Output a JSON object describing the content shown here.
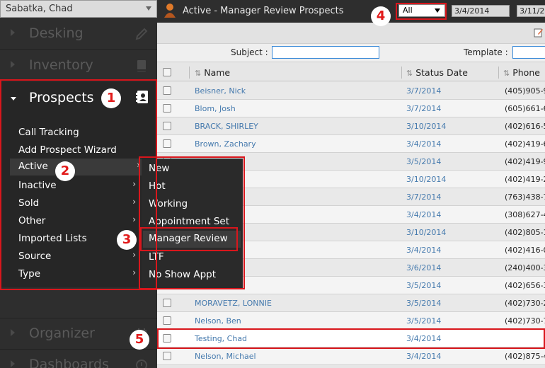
{
  "sidebar": {
    "user": "Sabatka, Chad",
    "sections": {
      "desking": "Desking",
      "inventory": "Inventory",
      "prospects": "Prospects",
      "organizer": "Organizer",
      "dashboards": "Dashboards"
    },
    "prospect_items": [
      "Call Tracking",
      "Add Prospect Wizard",
      "Active",
      "Inactive",
      "Sold",
      "Other",
      "Imported Lists",
      "Source",
      "Type"
    ]
  },
  "submenu": {
    "items": [
      "New",
      "Hot",
      "Working",
      "Appointment Set",
      "Manager Review",
      "LTF",
      "No Show Appt"
    ]
  },
  "header": {
    "title": "Active - Manager Review Prospects",
    "filter_value": "All",
    "date_start": "3/4/2014",
    "date_end": "3/11/201"
  },
  "search": {
    "subject_label": "Subject :",
    "template_label": "Template :"
  },
  "grid": {
    "columns": [
      "Name",
      "Status Date",
      "Phone"
    ],
    "rows": [
      {
        "name": "Beisner, Nick",
        "date": "3/7/2014",
        "phone": "(405)905-97"
      },
      {
        "name": "Blom, Josh",
        "date": "3/7/2014",
        "phone": "(605)661-64"
      },
      {
        "name": "BRACK, SHIRLEY",
        "date": "3/10/2014",
        "phone": "(402)616-51"
      },
      {
        "name": "Brown, Zachary",
        "date": "3/4/2014",
        "phone": "(402)419-63"
      },
      {
        "name": "",
        "date": "3/5/2014",
        "phone": "(402)419-93"
      },
      {
        "name": "",
        "date": "3/10/2014",
        "phone": "(402)419-24"
      },
      {
        "name": "",
        "date": "3/7/2014",
        "phone": "(763)438-76"
      },
      {
        "name": "",
        "date": "3/4/2014",
        "phone": "(308)627-43"
      },
      {
        "name": "",
        "date": "3/10/2014",
        "phone": "(402)805-11"
      },
      {
        "name": "",
        "date": "3/4/2014",
        "phone": "(402)416-08"
      },
      {
        "name": "",
        "date": "3/6/2014",
        "phone": "(240)400-31"
      },
      {
        "name": "",
        "date": "3/5/2014",
        "phone": "(402)656-33"
      },
      {
        "name": "MORAVETZ, LONNIE",
        "date": "3/5/2014",
        "phone": "(402)730-25"
      },
      {
        "name": "Nelson, Ben",
        "date": "3/5/2014",
        "phone": "(402)730-77"
      },
      {
        "name": "Testing, Chad",
        "date": "3/4/2014",
        "phone": ""
      },
      {
        "name": "Nelson, Michael",
        "date": "3/4/2014",
        "phone": "(402)875-40"
      }
    ]
  },
  "annotations": [
    "1",
    "2",
    "3",
    "4",
    "5"
  ],
  "colors": {
    "sidebar_bg": "#2e2e2e",
    "highlight_red": "#d9161c",
    "link_blue": "#4479ad"
  },
  "icons": {
    "desking": "pencil-icon",
    "inventory": "book-icon",
    "prospects": "contact-card-icon",
    "organizer": "calendar-icon",
    "dashboards": "gauge-icon"
  }
}
